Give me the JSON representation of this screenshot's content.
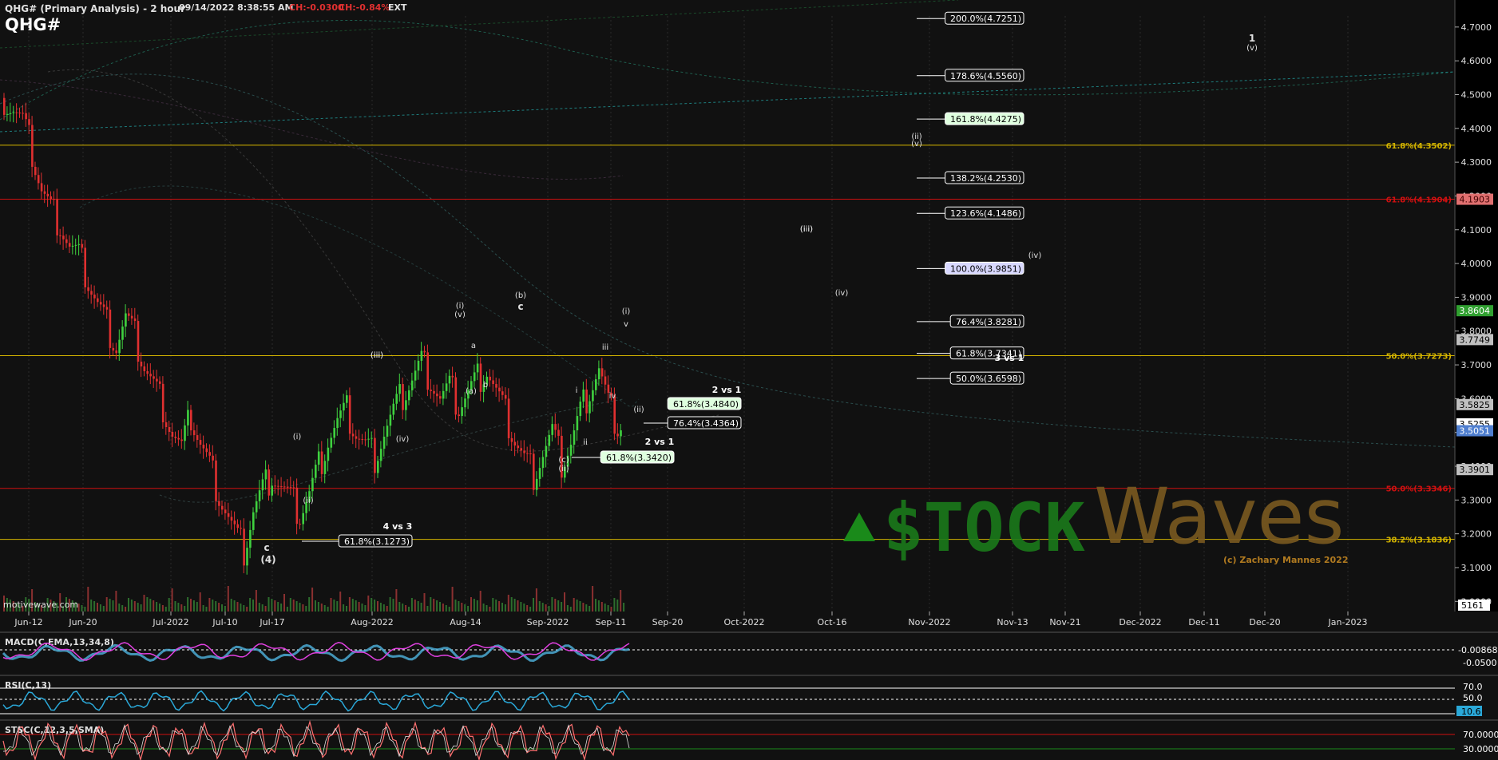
{
  "header": {
    "symbol_title": "QHG# (Primary Analysis) - 2 hour",
    "timestamp": "09/14/2022 8:38:55 AM",
    "change": "CH:-0.0300",
    "change_pct": "CH:-0.84%",
    "session": "EXT",
    "symbol": "QHG#"
  },
  "colors": {
    "background": "#111111",
    "up_candle": "#3fd13f",
    "down_candle": "#e03030",
    "yellow_line": "#d4b400",
    "red_line": "#d01010",
    "price_axis_bg": "#000000",
    "macd_line": "#4fb4e0",
    "macd_signal": "#e040e0",
    "rsi_line": "#2aa8d8",
    "stoch_k": "#ff7070",
    "stoch_d": "#e0e0e0"
  },
  "watermark": {
    "brand_left": "$TOCK",
    "brand_right": "Waves",
    "copyright": "(c) Zachary Mannes 2022",
    "site": "motivewave.com"
  },
  "chart_data": {
    "type": "candlestick",
    "title": "QHG# (Primary Analysis) - 2 hour",
    "x_tick_labels": [
      "Jun-12",
      "Jun-20",
      "Jul-2022",
      "Jul-10",
      "Jul-17",
      "Aug-2022",
      "Aug-14",
      "Sep-2022",
      "Sep-11",
      "Sep-20",
      "Oct-2022",
      "Oct-16",
      "Nov-2022",
      "Nov-13",
      "Nov-21",
      "Dec-2022",
      "Dec-11",
      "Dec-20",
      "Jan-2023"
    ],
    "y_ticks": [
      3.0,
      3.1,
      3.2,
      3.3,
      3.4,
      3.5,
      3.6,
      3.7,
      3.8,
      3.9,
      4.0,
      4.1,
      4.2,
      4.3,
      4.4,
      4.5,
      4.6,
      4.7
    ],
    "y_range": [
      2.97,
      4.78
    ],
    "price_path": [
      [
        0,
        4.49
      ],
      [
        3,
        4.46
      ],
      [
        6,
        4.42
      ],
      [
        9,
        4.33
      ],
      [
        12,
        4.22
      ],
      [
        15,
        4.16
      ],
      [
        18,
        4.12
      ],
      [
        21,
        4.05
      ],
      [
        24,
        4.02
      ],
      [
        27,
        3.95
      ],
      [
        30,
        3.88
      ],
      [
        33,
        3.82
      ],
      [
        36,
        3.76
      ],
      [
        39,
        3.84
      ],
      [
        42,
        3.78
      ],
      [
        45,
        3.7
      ],
      [
        48,
        3.64
      ],
      [
        51,
        3.58
      ],
      [
        54,
        3.5
      ],
      [
        57,
        3.45
      ],
      [
        60,
        3.55
      ],
      [
        63,
        3.47
      ],
      [
        66,
        3.4
      ],
      [
        69,
        3.32
      ],
      [
        72,
        3.25
      ],
      [
        75,
        3.18
      ],
      [
        77,
        3.15
      ],
      [
        80,
        3.27
      ],
      [
        83,
        3.33
      ],
      [
        86,
        3.38
      ],
      [
        89,
        3.34
      ],
      [
        92,
        3.3
      ],
      [
        95,
        3.26
      ],
      [
        98,
        3.32
      ],
      [
        101,
        3.4
      ],
      [
        104,
        3.48
      ],
      [
        107,
        3.53
      ],
      [
        110,
        3.56
      ],
      [
        113,
        3.5
      ],
      [
        116,
        3.46
      ],
      [
        119,
        3.43
      ],
      [
        122,
        3.5
      ],
      [
        125,
        3.56
      ],
      [
        128,
        3.61
      ],
      [
        131,
        3.66
      ],
      [
        134,
        3.71
      ],
      [
        137,
        3.66
      ],
      [
        140,
        3.6
      ],
      [
        143,
        3.63
      ],
      [
        146,
        3.58
      ],
      [
        149,
        3.62
      ],
      [
        152,
        3.66
      ],
      [
        155,
        3.69
      ],
      [
        158,
        3.62
      ],
      [
        161,
        3.55
      ],
      [
        164,
        3.48
      ],
      [
        167,
        3.42
      ],
      [
        170,
        3.38
      ],
      [
        173,
        3.44
      ],
      [
        176,
        3.5
      ],
      [
        179,
        3.41
      ],
      [
        182,
        3.47
      ],
      [
        185,
        3.56
      ],
      [
        188,
        3.63
      ],
      [
        191,
        3.69
      ],
      [
        194,
        3.58
      ],
      [
        197,
        3.52
      ],
      [
        199,
        3.53
      ]
    ],
    "volume_label": "5161",
    "horizontal_levels": [
      {
        "label": "61.8%(4.3502)",
        "value": 4.3502,
        "color": "#d4b400"
      },
      {
        "label": "61.8%(4.1904)",
        "value": 4.1904,
        "color": "#d01010"
      },
      {
        "label": "50.0%(3.7273)",
        "value": 3.7273,
        "color": "#d4b400"
      },
      {
        "label": "50.0%(3.3346)",
        "value": 3.3346,
        "color": "#d01010"
      },
      {
        "label": "38.2%(3.1836)",
        "value": 3.1836,
        "color": "#d4b400"
      }
    ],
    "fib_boxes": [
      {
        "label": "200.0%(4.7251)",
        "value": 4.7251,
        "highlight": false
      },
      {
        "label": "178.6%(4.5560)",
        "value": 4.556,
        "highlight": false
      },
      {
        "label": "161.8%(4.4275)",
        "value": 4.4275,
        "highlight": "green"
      },
      {
        "label": "138.2%(4.2530)",
        "value": 4.253,
        "highlight": false
      },
      {
        "label": "123.6%(4.1486)",
        "value": 4.1486,
        "highlight": false
      },
      {
        "label": "100.0%(3.9851)",
        "value": 3.9851,
        "highlight": "blue"
      },
      {
        "label": "76.4%(3.8281)",
        "value": 3.8281,
        "highlight": false
      },
      {
        "label": "61.8%(3.7341)",
        "value": 3.7341,
        "highlight": false
      },
      {
        "label": "50.0%(3.6598)",
        "value": 3.6598,
        "highlight": false
      }
    ],
    "group_labels": [
      "3 vs 1",
      "2 vs 1",
      "2 vs 1",
      "4 vs 3"
    ],
    "small_fib_boxes": [
      {
        "label": "61.8%(3.4840)",
        "value": 3.484,
        "highlight": "green"
      },
      {
        "label": "76.4%(3.4364)",
        "value": 3.4364,
        "highlight": false
      },
      {
        "label": "61.8%(3.3420)",
        "value": 3.342,
        "highlight": "green"
      },
      {
        "label": "61.8%(3.1273)",
        "value": 3.1273,
        "highlight": false
      }
    ],
    "wave_labels": [
      "(iii)",
      "(iv)",
      "(ii)",
      "iii",
      "(iii)",
      "i",
      "ii",
      "iv",
      "(i)",
      "(i)",
      "v",
      "(ii)",
      "(v)",
      "c",
      "(b)",
      "a",
      "b",
      "(a)",
      "(iii)",
      "(iv)",
      "(ii)",
      "(i)",
      "c",
      "(4)",
      "(c)",
      "(ii)",
      "1",
      "(v)",
      "(iii)",
      "(iv)",
      "(v)"
    ],
    "price_badges": [
      {
        "label": "4.1903",
        "value": 4.1903,
        "bg": "#e07070",
        "fg": "#400000"
      },
      {
        "label": "3.8604",
        "value": 3.8604,
        "bg": "#30a030",
        "fg": "#ffffff"
      },
      {
        "label": "3.7749",
        "value": 3.7749,
        "bg": "#c0c0c0",
        "fg": "#000000"
      },
      {
        "label": "3.5825",
        "value": 3.5825,
        "bg": "#c0c0c0",
        "fg": "#000000"
      },
      {
        "label": "3.5255",
        "value": 3.5255,
        "bg": "#ffffff",
        "fg": "#000000"
      },
      {
        "label": "3.5051",
        "value": 3.5051,
        "bg": "#4f7fd0",
        "fg": "#ffffff"
      },
      {
        "label": "3.3901",
        "value": 3.3901,
        "bg": "#c0c0c0",
        "fg": "#000000"
      }
    ]
  },
  "indicators": {
    "macd": {
      "label": "MACD(C,EMA,13,34,8)",
      "ticks": [
        "-0.00868",
        "-0.0500"
      ]
    },
    "rsi": {
      "label": "RSI(C,13)",
      "ticks": [
        "70.0",
        "50.0",
        "10.6"
      ]
    },
    "stoch": {
      "label": "STSC(C,12,3,5,SMA)",
      "ticks": [
        "70.0000",
        "30.0000"
      ]
    }
  }
}
